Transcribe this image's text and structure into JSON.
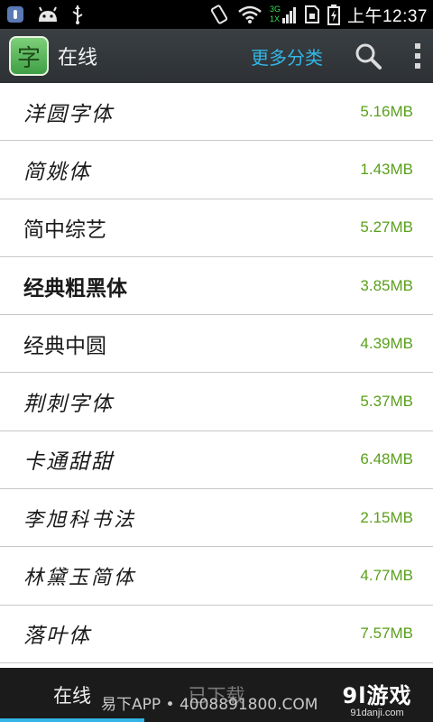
{
  "status_bar": {
    "icons": [
      "usb-debug-icon",
      "android-icon",
      "usb-icon",
      "rotate-icon",
      "wifi-icon",
      "signal-icon",
      "sim-icon",
      "battery-icon"
    ],
    "network_label_top": "3G",
    "network_label_bottom": "1X",
    "time": "上午12:37"
  },
  "action_bar": {
    "logo_char": "字",
    "title": "在线",
    "more_categories": "更多分类",
    "accent_color": "#33b5e5"
  },
  "fonts": [
    {
      "name": "洋圆字体",
      "size": "5.16MB"
    },
    {
      "name": "简姚体",
      "size": "1.43MB"
    },
    {
      "name": "简中综艺",
      "size": "5.27MB"
    },
    {
      "name": "经典粗黑体",
      "size": "3.85MB"
    },
    {
      "name": "经典中圆",
      "size": "4.39MB"
    },
    {
      "name": "荆刺字体",
      "size": "5.37MB"
    },
    {
      "name": "卡通甜甜",
      "size": "6.48MB"
    },
    {
      "name": "李旭科书法",
      "size": "2.15MB"
    },
    {
      "name": "林黛玉简体",
      "size": "4.77MB"
    },
    {
      "name": "落叶体",
      "size": "7.57MB"
    }
  ],
  "size_color": "#5aa01c",
  "bottom_tabs": [
    {
      "label": "在线",
      "active": true
    },
    {
      "label": "已下载",
      "active": false
    }
  ],
  "watermark": "易下APP • 4008891800.COM",
  "brand": {
    "main": "9l游戏",
    "sub": "91danji.com"
  }
}
